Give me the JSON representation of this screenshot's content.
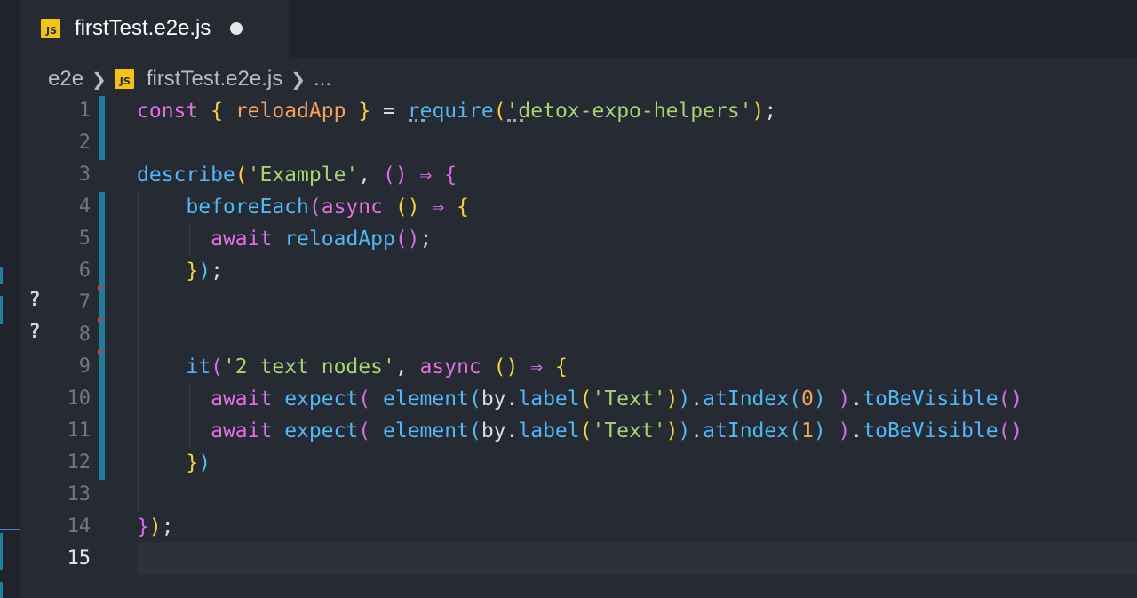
{
  "tab": {
    "badge": "JS",
    "filename": "firstTest.e2e.js"
  },
  "breadcrumb": {
    "folder": "e2e",
    "badge": "JS",
    "file": "firstTest.e2e.js",
    "more": "..."
  },
  "gutter_markers": [
    "?",
    "?"
  ],
  "line_numbers": [
    "1",
    "2",
    "3",
    "4",
    "5",
    "6",
    "7",
    "8",
    "9",
    "10",
    "11",
    "12",
    "13",
    "14",
    "15"
  ],
  "code": {
    "l1": {
      "kw": "const",
      "open": "{",
      "name": "reloadApp",
      "close": "}",
      "eq": "=",
      "req_first": "r",
      "req_rest": "equire",
      "po": "(",
      "q": "'",
      "str": "detox-expo-helpers'",
      "pc": ")",
      "semi": ";"
    },
    "l3": {
      "fn": "describe",
      "po": "(",
      "str": "'Example'",
      "comma": ",",
      "args": "()",
      "arrow": "⇒",
      "brace": "{"
    },
    "l4": {
      "fn": "beforeEach",
      "po": "(",
      "kw": "async",
      "args": "()",
      "arrow": "⇒",
      "brace": "{"
    },
    "l5": {
      "kw": "await",
      "fn": "reloadApp",
      "call": "()",
      "semi": ";"
    },
    "l6": {
      "brace": "}",
      "pc": ")",
      "semi": ";"
    },
    "l9": {
      "fn": "it",
      "po": "(",
      "str": "'2 text nodes'",
      "comma": ",",
      "kw": "async",
      "args": "()",
      "arrow": "⇒",
      "brace": "{"
    },
    "l10": {
      "kw": "await",
      "fn_expect": "expect",
      "po1": "(",
      "fn_el": "element",
      "po2": "(",
      "by": "by",
      "dot1": ".",
      "fn_label": "label",
      "po3": "(",
      "str": "'Text'",
      "pc3": ")",
      "pc2": ")",
      "dot2": ".",
      "fn_at": "atIndex",
      "po4": "(",
      "num": "0",
      "pc4": ")",
      "pc1": ")",
      "dot3": ".",
      "fn_vis": "toBeVisible",
      "call": "()"
    },
    "l11": {
      "kw": "await",
      "fn_expect": "expect",
      "po1": "(",
      "fn_el": "element",
      "po2": "(",
      "by": "by",
      "dot1": ".",
      "fn_label": "label",
      "po3": "(",
      "str": "'Text'",
      "pc3": ")",
      "pc2": ")",
      "dot2": ".",
      "fn_at": "atIndex",
      "po4": "(",
      "num": "1",
      "pc4": ")",
      "pc1": ")",
      "dot3": ".",
      "fn_vis": "toBeVisible",
      "call": "()"
    },
    "l12": {
      "brace": "}",
      "pc": ")"
    },
    "l14": {
      "brace": "}",
      "pc": ")",
      "semi": ";"
    }
  },
  "colors": {
    "background": "#262a33",
    "keyword": "#e36ee6",
    "function": "#4fb8f5",
    "string": "#a8d372",
    "variable": "#f5a259",
    "bracket": "#f6d23b",
    "git_modified": "#1f7d9e"
  }
}
